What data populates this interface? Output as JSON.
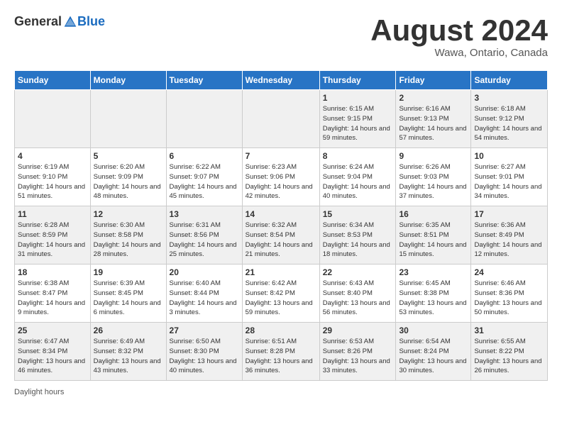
{
  "header": {
    "logo_general": "General",
    "logo_blue": "Blue",
    "month_title": "August 2024",
    "location": "Wawa, Ontario, Canada"
  },
  "days_of_week": [
    "Sunday",
    "Monday",
    "Tuesday",
    "Wednesday",
    "Thursday",
    "Friday",
    "Saturday"
  ],
  "weeks": [
    [
      {
        "num": "",
        "info": ""
      },
      {
        "num": "",
        "info": ""
      },
      {
        "num": "",
        "info": ""
      },
      {
        "num": "",
        "info": ""
      },
      {
        "num": "1",
        "info": "Sunrise: 6:15 AM\nSunset: 9:15 PM\nDaylight: 14 hours and 59 minutes."
      },
      {
        "num": "2",
        "info": "Sunrise: 6:16 AM\nSunset: 9:13 PM\nDaylight: 14 hours and 57 minutes."
      },
      {
        "num": "3",
        "info": "Sunrise: 6:18 AM\nSunset: 9:12 PM\nDaylight: 14 hours and 54 minutes."
      }
    ],
    [
      {
        "num": "4",
        "info": "Sunrise: 6:19 AM\nSunset: 9:10 PM\nDaylight: 14 hours and 51 minutes."
      },
      {
        "num": "5",
        "info": "Sunrise: 6:20 AM\nSunset: 9:09 PM\nDaylight: 14 hours and 48 minutes."
      },
      {
        "num": "6",
        "info": "Sunrise: 6:22 AM\nSunset: 9:07 PM\nDaylight: 14 hours and 45 minutes."
      },
      {
        "num": "7",
        "info": "Sunrise: 6:23 AM\nSunset: 9:06 PM\nDaylight: 14 hours and 42 minutes."
      },
      {
        "num": "8",
        "info": "Sunrise: 6:24 AM\nSunset: 9:04 PM\nDaylight: 14 hours and 40 minutes."
      },
      {
        "num": "9",
        "info": "Sunrise: 6:26 AM\nSunset: 9:03 PM\nDaylight: 14 hours and 37 minutes."
      },
      {
        "num": "10",
        "info": "Sunrise: 6:27 AM\nSunset: 9:01 PM\nDaylight: 14 hours and 34 minutes."
      }
    ],
    [
      {
        "num": "11",
        "info": "Sunrise: 6:28 AM\nSunset: 8:59 PM\nDaylight: 14 hours and 31 minutes."
      },
      {
        "num": "12",
        "info": "Sunrise: 6:30 AM\nSunset: 8:58 PM\nDaylight: 14 hours and 28 minutes."
      },
      {
        "num": "13",
        "info": "Sunrise: 6:31 AM\nSunset: 8:56 PM\nDaylight: 14 hours and 25 minutes."
      },
      {
        "num": "14",
        "info": "Sunrise: 6:32 AM\nSunset: 8:54 PM\nDaylight: 14 hours and 21 minutes."
      },
      {
        "num": "15",
        "info": "Sunrise: 6:34 AM\nSunset: 8:53 PM\nDaylight: 14 hours and 18 minutes."
      },
      {
        "num": "16",
        "info": "Sunrise: 6:35 AM\nSunset: 8:51 PM\nDaylight: 14 hours and 15 minutes."
      },
      {
        "num": "17",
        "info": "Sunrise: 6:36 AM\nSunset: 8:49 PM\nDaylight: 14 hours and 12 minutes."
      }
    ],
    [
      {
        "num": "18",
        "info": "Sunrise: 6:38 AM\nSunset: 8:47 PM\nDaylight: 14 hours and 9 minutes."
      },
      {
        "num": "19",
        "info": "Sunrise: 6:39 AM\nSunset: 8:45 PM\nDaylight: 14 hours and 6 minutes."
      },
      {
        "num": "20",
        "info": "Sunrise: 6:40 AM\nSunset: 8:44 PM\nDaylight: 14 hours and 3 minutes."
      },
      {
        "num": "21",
        "info": "Sunrise: 6:42 AM\nSunset: 8:42 PM\nDaylight: 13 hours and 59 minutes."
      },
      {
        "num": "22",
        "info": "Sunrise: 6:43 AM\nSunset: 8:40 PM\nDaylight: 13 hours and 56 minutes."
      },
      {
        "num": "23",
        "info": "Sunrise: 6:45 AM\nSunset: 8:38 PM\nDaylight: 13 hours and 53 minutes."
      },
      {
        "num": "24",
        "info": "Sunrise: 6:46 AM\nSunset: 8:36 PM\nDaylight: 13 hours and 50 minutes."
      }
    ],
    [
      {
        "num": "25",
        "info": "Sunrise: 6:47 AM\nSunset: 8:34 PM\nDaylight: 13 hours and 46 minutes."
      },
      {
        "num": "26",
        "info": "Sunrise: 6:49 AM\nSunset: 8:32 PM\nDaylight: 13 hours and 43 minutes."
      },
      {
        "num": "27",
        "info": "Sunrise: 6:50 AM\nSunset: 8:30 PM\nDaylight: 13 hours and 40 minutes."
      },
      {
        "num": "28",
        "info": "Sunrise: 6:51 AM\nSunset: 8:28 PM\nDaylight: 13 hours and 36 minutes."
      },
      {
        "num": "29",
        "info": "Sunrise: 6:53 AM\nSunset: 8:26 PM\nDaylight: 13 hours and 33 minutes."
      },
      {
        "num": "30",
        "info": "Sunrise: 6:54 AM\nSunset: 8:24 PM\nDaylight: 13 hours and 30 minutes."
      },
      {
        "num": "31",
        "info": "Sunrise: 6:55 AM\nSunset: 8:22 PM\nDaylight: 13 hours and 26 minutes."
      }
    ]
  ],
  "footer": "Daylight hours"
}
